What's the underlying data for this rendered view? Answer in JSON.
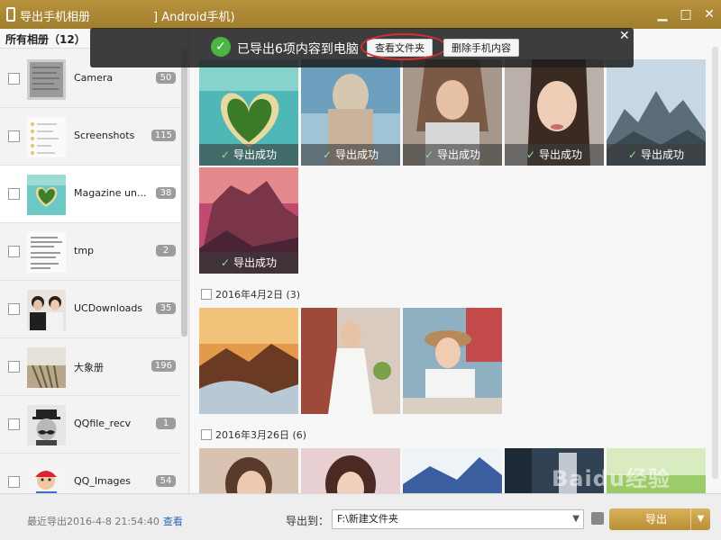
{
  "titlebar": {
    "title": "导出手机相册",
    "device": "] Android手机)",
    "minimize": "▁",
    "maximize": "□",
    "close": "✕"
  },
  "sidebar": {
    "header": "所有相册（12）",
    "albums": [
      {
        "name": "Camera",
        "count": "50"
      },
      {
        "name": "Screenshots",
        "count": "115"
      },
      {
        "name": "Magazine un...",
        "count": "38"
      },
      {
        "name": "tmp",
        "count": "2"
      },
      {
        "name": "UCDownloads",
        "count": "35"
      },
      {
        "name": "大象册",
        "count": "196"
      },
      {
        "name": "QQfile_recv",
        "count": "1"
      },
      {
        "name": "QQ_Images",
        "count": "54"
      }
    ]
  },
  "notification": {
    "message": "已导出6项内容到电脑",
    "view_folder": "查看文件夹",
    "delete_phone": "删除手机内容",
    "close": "✕"
  },
  "gallery": {
    "success_label": "导出成功",
    "groups": [
      {
        "title": "2016年4月2日 (3)"
      },
      {
        "title": "2016年3月26日 (6)"
      }
    ]
  },
  "bottom": {
    "last_export": "最近导出2016-4-8 21:54:40",
    "view_link": "查看",
    "export_to_label": "导出到：",
    "path": "F:\\新建文件夹",
    "export_button": "导出"
  },
  "watermark": "Baidu经验",
  "colors": {
    "titlebar": "#a98534",
    "success_green": "#4bb543",
    "highlight_red": "#d43030",
    "link_blue": "#2a66b5"
  }
}
